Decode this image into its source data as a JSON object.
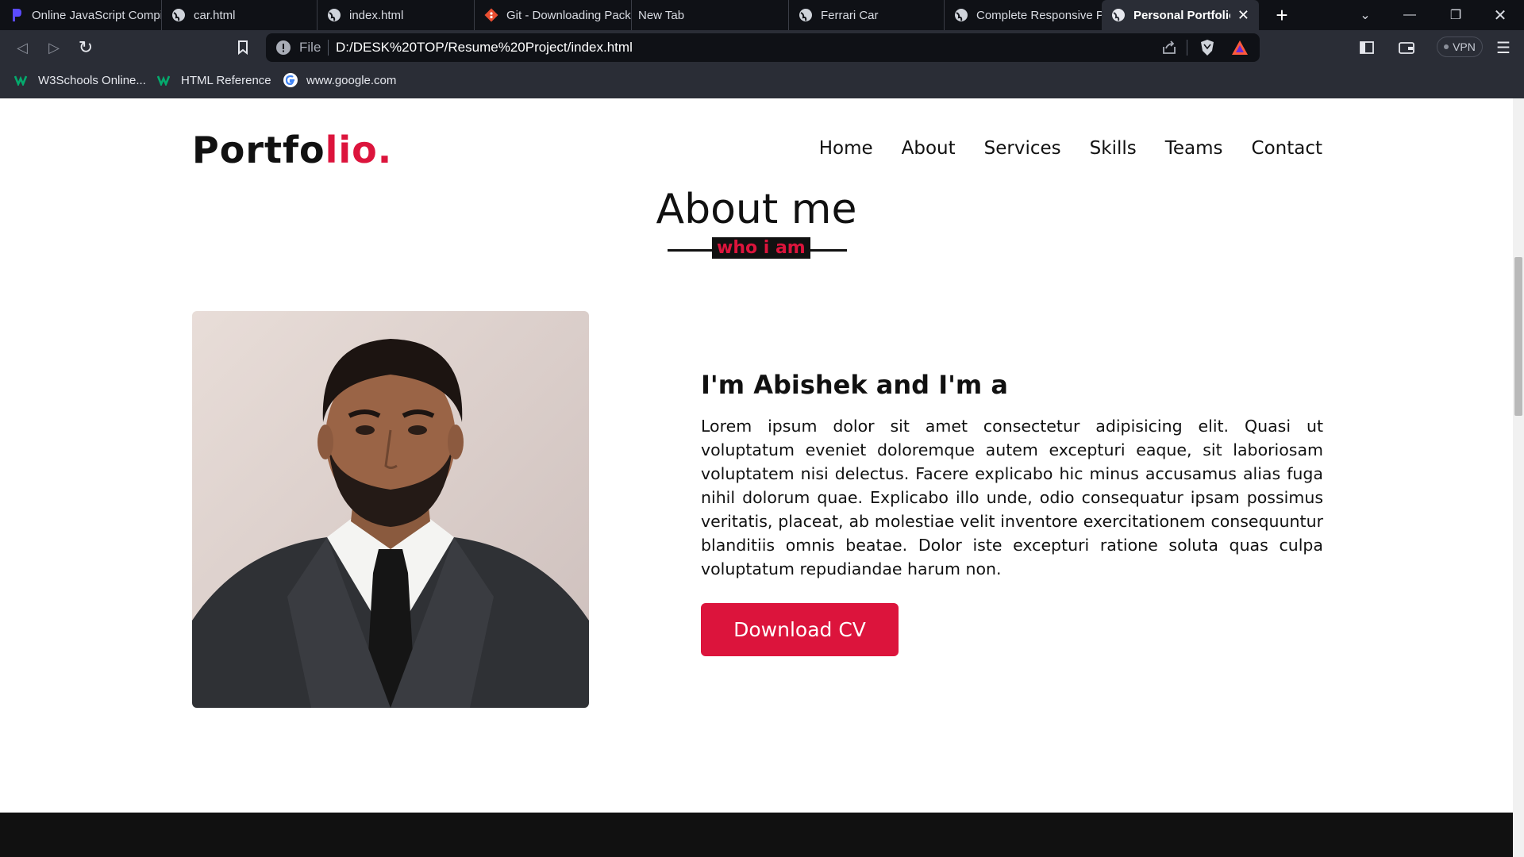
{
  "browser": {
    "tabs": [
      {
        "title": "Online JavaScript Compiler",
        "icon": "programiz-icon"
      },
      {
        "title": "car.html",
        "icon": "globe-icon"
      },
      {
        "title": "index.html",
        "icon": "globe-icon"
      },
      {
        "title": "Git - Downloading Package",
        "icon": "git-icon"
      },
      {
        "title": "New Tab",
        "icon": ""
      },
      {
        "title": "Ferrari Car",
        "icon": "globe-icon"
      },
      {
        "title": "Complete Responsive Personal Portfolio",
        "icon": "globe-icon"
      },
      {
        "title": "Personal Portfolio",
        "icon": "globe-icon",
        "active": true
      }
    ],
    "url_scheme": "File",
    "url": "D:/DESK%20TOP/Resume%20Project/index.html",
    "vpn_label": "VPN",
    "bookmarks": [
      {
        "label": "W3Schools Online...",
        "icon": "w3schools-icon"
      },
      {
        "label": "HTML Reference",
        "icon": "w3schools-icon"
      },
      {
        "label": "www.google.com",
        "icon": "google-icon"
      }
    ]
  },
  "site": {
    "logo_main": "Portfo",
    "logo_accent": "lio.",
    "nav": [
      "Home",
      "About",
      "Services",
      "Skills",
      "Teams",
      "Contact"
    ],
    "accent_color": "#dc143c"
  },
  "about": {
    "title": "About me",
    "subtitle": "who i am",
    "intro": "I'm Abishek and I'm a",
    "paragraph": "Lorem ipsum dolor sit amet consectetur adipisicing elit. Quasi ut voluptatum eveniet doloremque autem excepturi eaque, sit laboriosam voluptatem nisi delectus. Facere explicabo hic minus accusamus alias fuga nihil dolorum quae. Explicabo illo unde, odio consequatur ipsam possimus veritatis, placeat, ab molestiae velit inventore exercitationem consequuntur blanditiis omnis beatae. Dolor iste excepturi ratione soluta quas culpa voluptatum repudiandae harum non.",
    "button": "Download CV"
  }
}
